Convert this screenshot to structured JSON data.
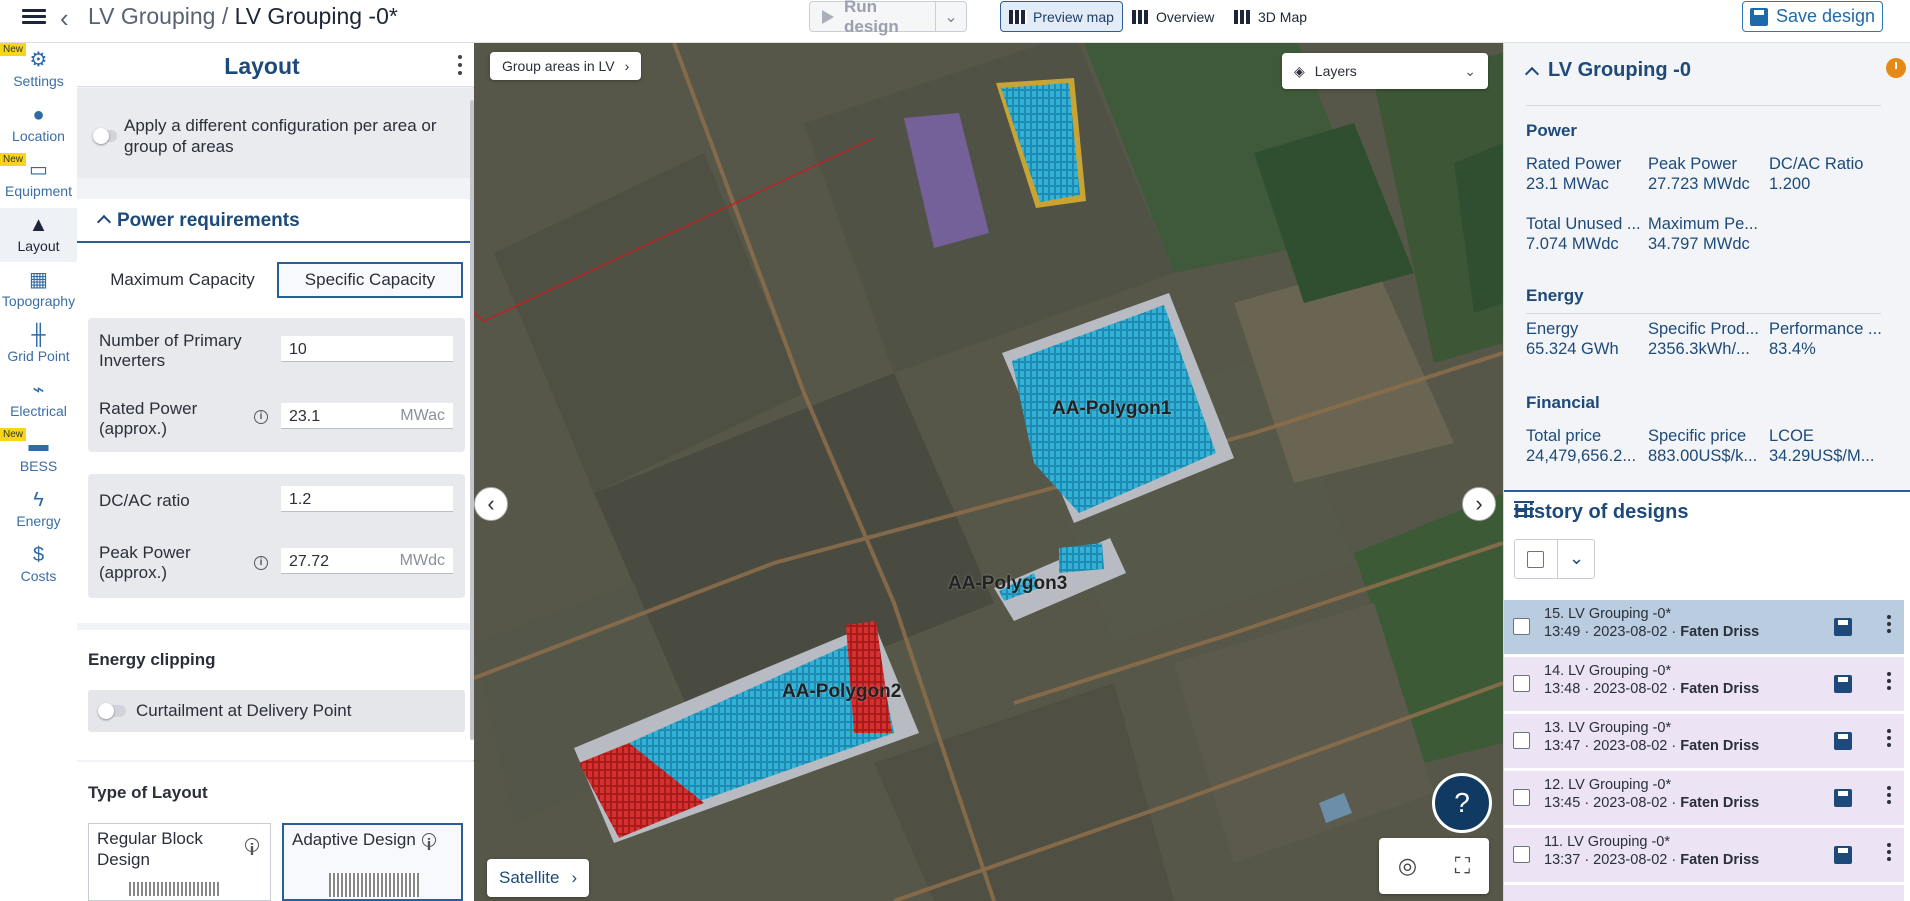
{
  "header": {
    "breadcrumb_parent": "LV Grouping",
    "breadcrumb_sep": " / ",
    "breadcrumb_current": "LV Grouping -0*",
    "run_label": "Run design",
    "tabs": [
      {
        "label": "Preview map",
        "active": true
      },
      {
        "label": "Overview",
        "active": false
      },
      {
        "label": "3D Map",
        "active": false
      }
    ],
    "save_label": "Save design"
  },
  "rail": {
    "new_badge": "New",
    "items": [
      {
        "label": "Settings",
        "icon": "gear-icon",
        "new": true
      },
      {
        "label": "Location",
        "icon": "pin-icon",
        "new": false
      },
      {
        "label": "Equipment",
        "icon": "solar-panel-icon",
        "new": true
      },
      {
        "label": "Layout",
        "icon": "mountain-icon",
        "new": false,
        "active": true
      },
      {
        "label": "Topography",
        "icon": "topography-icon",
        "new": false
      },
      {
        "label": "Grid Point",
        "icon": "tower-icon",
        "new": false
      },
      {
        "label": "Electrical",
        "icon": "electrical-icon",
        "new": false
      },
      {
        "label": "BESS",
        "icon": "battery-icon",
        "new": true
      },
      {
        "label": "Energy",
        "icon": "bolt-icon",
        "new": false
      },
      {
        "label": "Costs",
        "icon": "dollar-icon",
        "new": false
      }
    ]
  },
  "layout_panel": {
    "title": "Layout",
    "config_toggle_label": "Apply a different configuration per area or group of areas",
    "power_section_title": "Power requirements",
    "capacity_options": [
      "Maximum Capacity",
      "Specific Capacity"
    ],
    "selected_capacity": "Specific Capacity",
    "primary_inverters_label": "Number of Primary Inverters",
    "primary_inverters_value": "10",
    "rated_power_label": "Rated Power (approx.)",
    "rated_power_value": "23.1",
    "rated_power_unit": "MWac",
    "dcac_label": "DC/AC ratio",
    "dcac_value": "1.2",
    "peak_power_label": "Peak Power (approx.)",
    "peak_power_value": "27.72",
    "peak_power_unit": "MWdc",
    "energy_clipping_title": "Energy clipping",
    "curtailment_label": "Curtailment at Delivery Point",
    "type_of_layout_title": "Type of Layout",
    "layout_options": [
      "Regular Block Design",
      "Adaptive Design"
    ],
    "selected_layout": "Adaptive Design"
  },
  "map": {
    "group_areas_label": "Group areas in LV",
    "layers_label": "Layers",
    "basemap_label": "Satellite",
    "help_label": "?",
    "polygons": [
      "AA-Polygon1",
      "AA-Polygon2",
      "AA-Polygon3"
    ]
  },
  "kpis": {
    "title": "LV Grouping -0",
    "power_title": "Power",
    "power": [
      {
        "label": "Rated Power",
        "value": "23.1 MWac"
      },
      {
        "label": "Peak Power",
        "value": "27.723 MWdc"
      },
      {
        "label": "DC/AC Ratio",
        "value": "1.200"
      },
      {
        "label": "Total Unused ...",
        "value": "7.074 MWdc"
      },
      {
        "label": "Maximum Pe...",
        "value": "34.797 MWdc"
      }
    ],
    "energy_title": "Energy",
    "energy": [
      {
        "label": "Energy",
        "value": "65.324 GWh"
      },
      {
        "label": "Specific Prod...",
        "value": "2356.3kWh/..."
      },
      {
        "label": "Performance ...",
        "value": "83.4%"
      }
    ],
    "financial_title": "Financial",
    "financial": [
      {
        "label": "Total price",
        "value": "24,479,656.2..."
      },
      {
        "label": "Specific price",
        "value": "883.00US$/k..."
      },
      {
        "label": "LCOE",
        "value": "34.29US$/M..."
      }
    ]
  },
  "history": {
    "title": "History of designs",
    "rows": [
      {
        "name": "15. LV Grouping -0*",
        "time": "13:49 · 2023-08-02 · ",
        "author": "Faten Driss"
      },
      {
        "name": "14. LV Grouping -0*",
        "time": "13:48 · 2023-08-02 · ",
        "author": "Faten Driss"
      },
      {
        "name": "13. LV Grouping -0*",
        "time": "13:47 · 2023-08-02 · ",
        "author": "Faten Driss"
      },
      {
        "name": "12. LV Grouping -0*",
        "time": "13:45 · 2023-08-02 · ",
        "author": "Faten Driss"
      },
      {
        "name": "11. LV Grouping -0*",
        "time": "13:37 · 2023-08-02 · ",
        "author": "Faten Driss"
      }
    ]
  },
  "colors": {
    "primary": "#1d4a7a",
    "accent": "#2b5e97",
    "panel_blue": "#2aa3c4",
    "panel_red": "#cc2a2a",
    "history_row": "#ece4f4",
    "history_row_selected": "#b9cce0"
  }
}
